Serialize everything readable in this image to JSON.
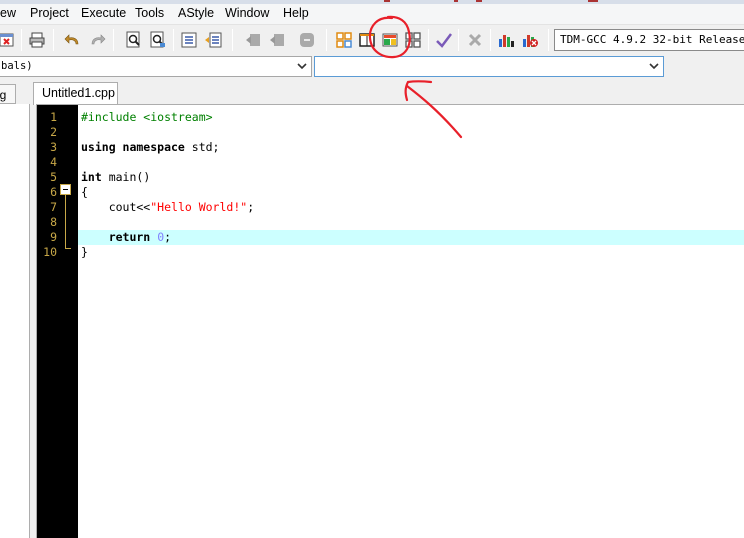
{
  "menu": {
    "items": [
      "ew",
      "Project",
      "Execute",
      "Tools",
      "AStyle",
      "Window",
      "Help"
    ]
  },
  "toolbar": {
    "icons": [
      "close-icon",
      "print-icon",
      "undo-icon",
      "redo-icon",
      "find-icon",
      "replace-icon",
      "indent-icon",
      "unindent-icon",
      "bookmark-back-icon",
      "bookmark-forward-icon",
      "comment-icon",
      "tile-icon",
      "window-icon",
      "color-grid-icon",
      "layout-icon",
      "check-icon",
      "delete-icon",
      "chart-icon",
      "profile-icon"
    ],
    "compiler": "TDM-GCC 4.9.2 32-bit Release"
  },
  "combos": {
    "class_value": "bals)",
    "function_value": ""
  },
  "tabs": {
    "left_panel_tab": "ug",
    "file_tab": "Untitled1.cpp"
  },
  "editor": {
    "line_numbers": [
      "1",
      "2",
      "3",
      "4",
      "5",
      "6",
      "7",
      "8",
      "9",
      "10"
    ],
    "lines": {
      "l1": "#include <iostream>",
      "l3a": "using namespace",
      "l3b": " std;",
      "l5a": "int",
      "l5b": " main()",
      "l6": "{",
      "l7a": "    cout<<",
      "l7b": "\"Hello World!\"",
      "l7c": ";",
      "l9a": "    return",
      "l9b": " ",
      "l9c": "0",
      "l9d": ";",
      "l10": "}"
    }
  },
  "colors": {
    "gutter": "#000000",
    "line_number": "#c8a848",
    "active_line": "#ccffff",
    "string": "#ff0000",
    "number": "#8080ff",
    "preprocessor": "#008000",
    "annotation": "#e8202a"
  }
}
